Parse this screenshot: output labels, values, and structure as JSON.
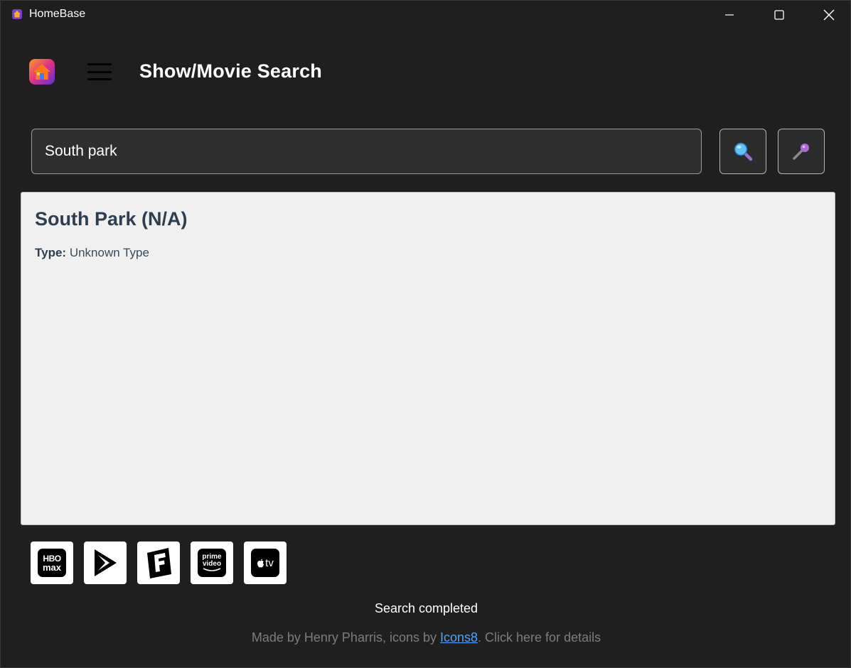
{
  "window": {
    "title": "HomeBase"
  },
  "header": {
    "title": "Show/Movie Search"
  },
  "search": {
    "value": "South park"
  },
  "result": {
    "title": "South Park (N/A)",
    "type_label": "Type:",
    "type_value": "Unknown Type"
  },
  "services": [
    {
      "name": "HBO Max",
      "icon": "hbo-max-icon",
      "line1": "HBO",
      "line2": "max"
    },
    {
      "name": "Google Play",
      "icon": "google-play-icon"
    },
    {
      "name": "Fandango",
      "icon": "fandango-icon"
    },
    {
      "name": "Prime Video",
      "icon": "prime-video-icon",
      "line1": "prime",
      "line2": "video"
    },
    {
      "name": "Apple TV",
      "icon": "apple-tv-icon",
      "label": "tv"
    }
  ],
  "status": {
    "text": "Search completed"
  },
  "footer": {
    "prefix": "Made by Henry Pharris, icons by ",
    "link": "Icons8",
    "suffix": ". Click here for details"
  },
  "colors": {
    "background": "#1f1f1f",
    "panel": "#f0f0f0",
    "result_text": "#2c3e50",
    "link": "#4aa3ff"
  }
}
